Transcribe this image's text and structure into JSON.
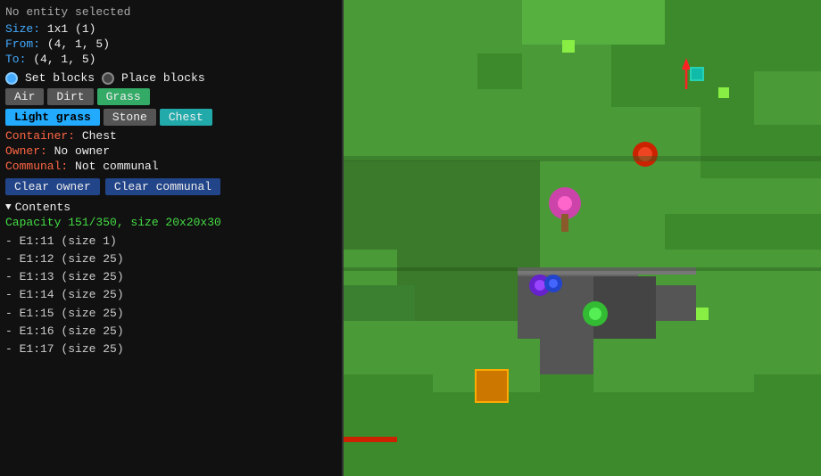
{
  "panel": {
    "no_entity": "No entity selected",
    "size_label": "Size:",
    "size_value": "1x1 (1)",
    "from_label": "From:",
    "from_value": "(4, 1, 5)",
    "to_label": "To:",
    "to_value": "(4, 1, 5)",
    "set_blocks_label": "Set blocks",
    "place_blocks_label": "Place blocks",
    "blocks": [
      "Air",
      "Dirt",
      "Grass",
      "Light grass",
      "Stone",
      "Chest"
    ],
    "active_block": "Light grass",
    "container_label": "Container:",
    "container_value": "Chest",
    "owner_label": "Owner:",
    "owner_value": "No owner",
    "communal_label": "Communal:",
    "communal_value": "Not communal",
    "clear_owner_label": "Clear owner",
    "clear_communal_label": "Clear communal",
    "contents_header": "Contents",
    "capacity_label": "Capacity 151/350, size 20x20x30",
    "items": [
      "- E1:11 (size 1)",
      "- E1:12 (size 25)",
      "- E1:13 (size 25)",
      "- E1:14 (size 25)",
      "- E1:15 (size 25)",
      "- E1:16 (size 25)",
      "- E1:17 (size 25)"
    ]
  },
  "colors": {
    "accent": "#4aaeff",
    "prop_label": "#ff6644",
    "capacity": "#44dd44",
    "btn_active_bg": "#22aaff"
  }
}
